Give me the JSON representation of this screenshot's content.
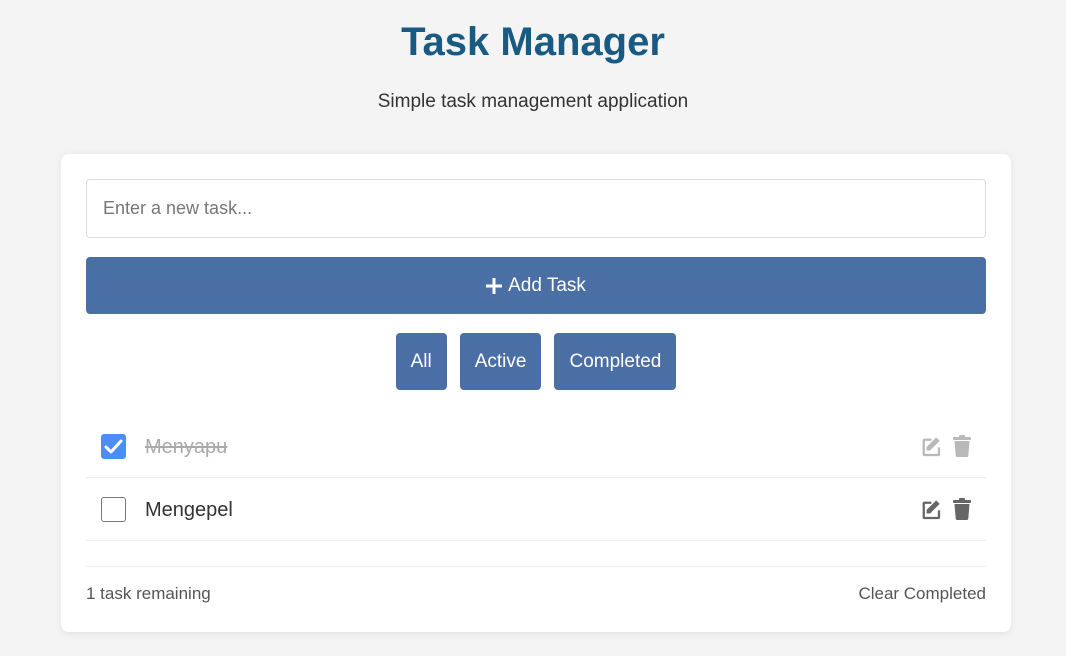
{
  "header": {
    "title": "Task Manager",
    "subtitle": "Simple task management application"
  },
  "input": {
    "placeholder": "Enter a new task...",
    "value": ""
  },
  "add_button": {
    "label": "Add Task",
    "icon": "plus-icon"
  },
  "filters": [
    {
      "label": "All"
    },
    {
      "label": "Active"
    },
    {
      "label": "Completed"
    }
  ],
  "tasks": [
    {
      "text": "Menyapu",
      "completed": true
    },
    {
      "text": "Mengepel",
      "completed": false
    }
  ],
  "footer": {
    "remaining": "1 task remaining",
    "clear_label": "Clear Completed"
  },
  "colors": {
    "title": "#195a82",
    "primary": "#4a6fa5",
    "checkbox_checked": "#4c8ef7",
    "background": "#f4f4f4"
  }
}
